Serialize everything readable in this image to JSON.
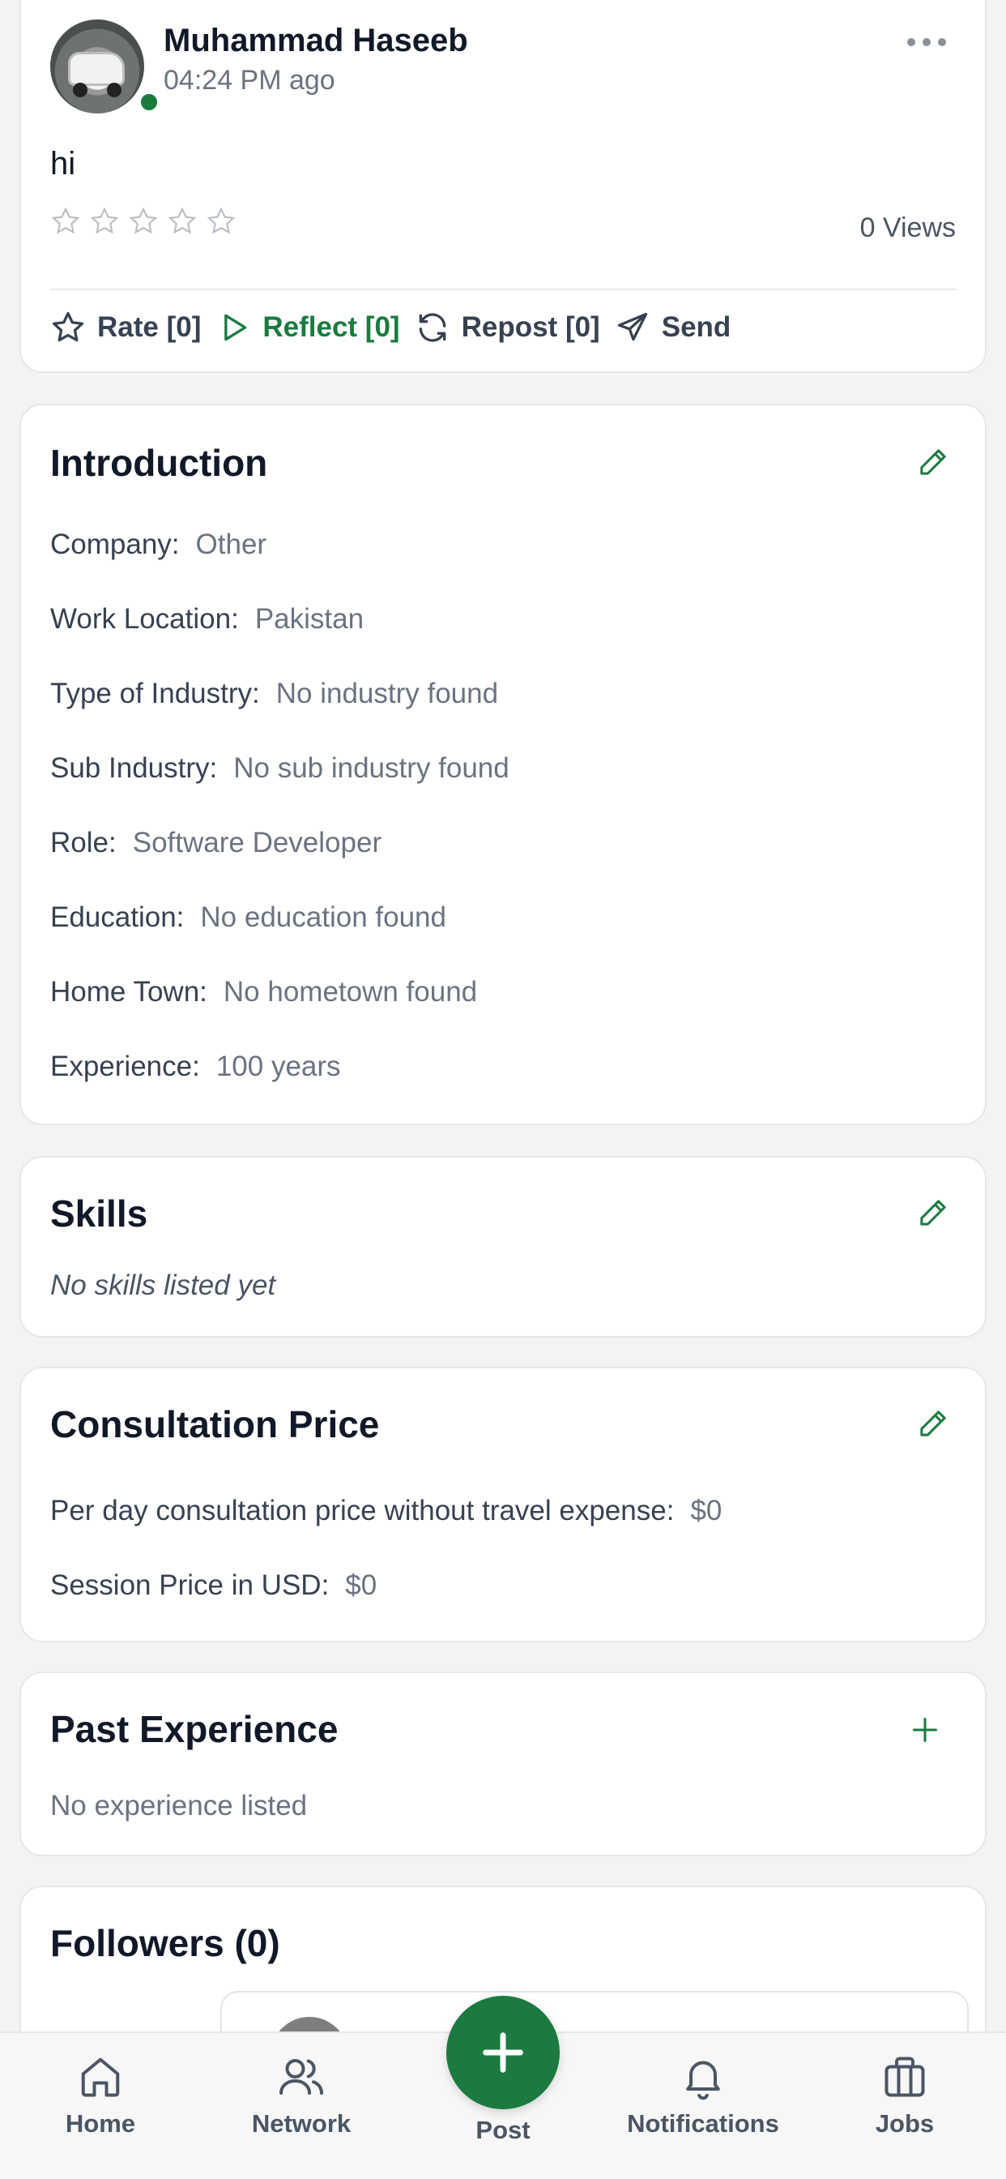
{
  "post": {
    "author": "Muhammad Haseeb",
    "time": "04:24 PM ago",
    "text": "hi",
    "rating": 0,
    "views": "0 Views",
    "actions": {
      "rate": "Rate [0]",
      "reflect": "Reflect [0]",
      "repost": "Repost [0]",
      "send": "Send"
    }
  },
  "introduction": {
    "title": "Introduction",
    "rows": [
      {
        "label": "Company:",
        "value": "Other"
      },
      {
        "label": "Work Location:",
        "value": "Pakistan"
      },
      {
        "label": "Type of Industry:",
        "value": "No industry found"
      },
      {
        "label": "Sub Industry:",
        "value": "No sub industry found"
      },
      {
        "label": "Role:",
        "value": "Software Developer"
      },
      {
        "label": "Education:",
        "value": "No education found"
      },
      {
        "label": "Home Town:",
        "value": "No hometown found"
      },
      {
        "label": "Experience:",
        "value": "100 years"
      }
    ]
  },
  "skills": {
    "title": "Skills",
    "empty": "No skills listed yet"
  },
  "consultation": {
    "title": "Consultation Price",
    "rows": [
      {
        "label": "Per day consultation price without travel expense:",
        "value": "$0"
      },
      {
        "label": "Session Price in USD:",
        "value": "$0"
      }
    ]
  },
  "past_experience": {
    "title": "Past Experience",
    "empty": "No experience listed"
  },
  "followers": {
    "title": "Followers (0)"
  },
  "nav": {
    "home": "Home",
    "network": "Network",
    "post": "Post",
    "notifications": "Notifications",
    "jobs": "Jobs"
  },
  "colors": {
    "accent": "#1a7a3f",
    "online": "#1b7a3e"
  }
}
